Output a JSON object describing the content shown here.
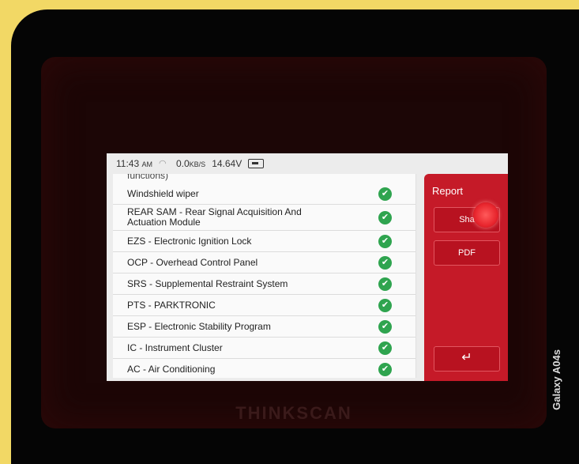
{
  "camera_watermark": "Galaxy A04s",
  "device_brand": "THINKSCAN",
  "status_bar": {
    "time": "11:43",
    "meridiem": "AM",
    "net_speed": "0.0",
    "net_unit": "KB/S",
    "voltage": "14.64V"
  },
  "list": {
    "partial_item": "functions)",
    "items": [
      {
        "label": "Windshield wiper"
      },
      {
        "label": "REAR SAM - Rear Signal Acquisition And Actuation Module"
      },
      {
        "label": "EZS - Electronic Ignition Lock"
      },
      {
        "label": "OCP - Overhead Control Panel"
      },
      {
        "label": "SRS - Supplemental Restraint System"
      },
      {
        "label": "PTS - PARKTRONIC"
      },
      {
        "label": "ESP - Electronic Stability Program"
      },
      {
        "label": "IC - Instrument Cluster"
      },
      {
        "label": "AC - Air Conditioning"
      }
    ]
  },
  "sidebar": {
    "title": "Report",
    "share_label": "Sha",
    "pdf_label": "PDF",
    "back_icon": "↵"
  },
  "icons": {
    "status_ok": "✔",
    "wifi": "wifi-icon",
    "battery": "battery-icon"
  },
  "colors": {
    "sidebar": "#c51a28",
    "check": "#2fa44f",
    "frame": "#f2d865"
  }
}
